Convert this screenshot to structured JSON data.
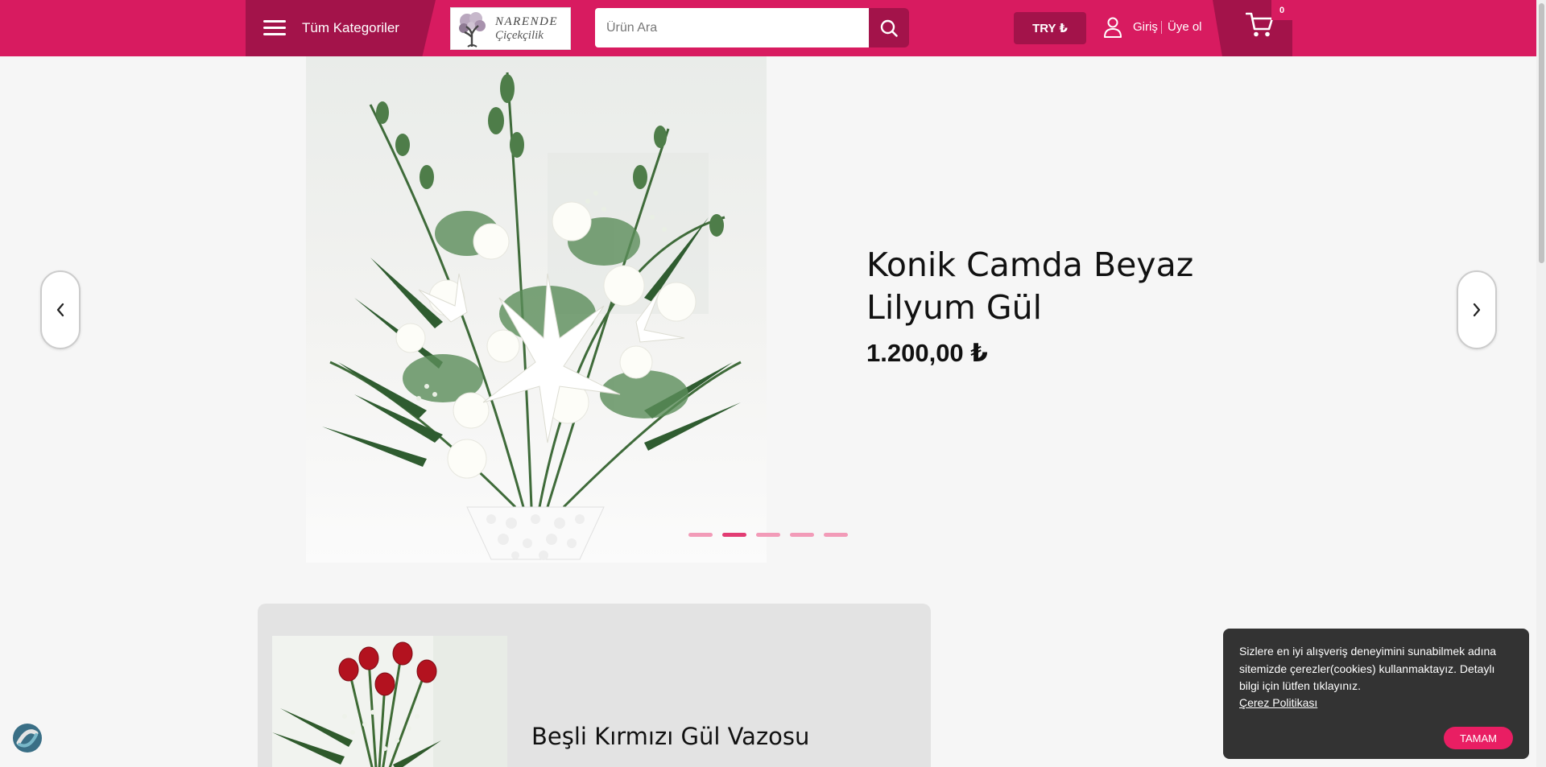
{
  "header": {
    "categories_label": "Tüm Kategoriler",
    "logo_line1": "NARENDE",
    "logo_line2": "Çiçekçilik",
    "search_placeholder": "Ürün Ara",
    "currency": "TRY ₺",
    "login": "Giriş",
    "register": "Üye ol",
    "cart_count": "0",
    "colors": {
      "primary": "#d81b60",
      "dark": "#a3134a"
    }
  },
  "slider": {
    "title": "Konik Camda Beyaz Lilyum Gül",
    "price": "1.200,00 ₺",
    "dot_count": 5,
    "active_dot": 2
  },
  "product_card": {
    "title": "Beşli Kırmızı Gül Vazosu"
  },
  "cookie": {
    "text": "Sizlere en iyi alışveriş deneyimini sunabilmek adına sitemizde çerezler(cookies) kullanmaktayız. Detaylı bilgi için lütfen tıklayınız.",
    "link": "Çerez Politikası",
    "button": "TAMAM"
  },
  "icons": [
    "hamburger-icon",
    "search-icon",
    "user-icon",
    "cart-icon",
    "chevron-left-icon",
    "chevron-right-icon",
    "chat-widget-icon"
  ]
}
